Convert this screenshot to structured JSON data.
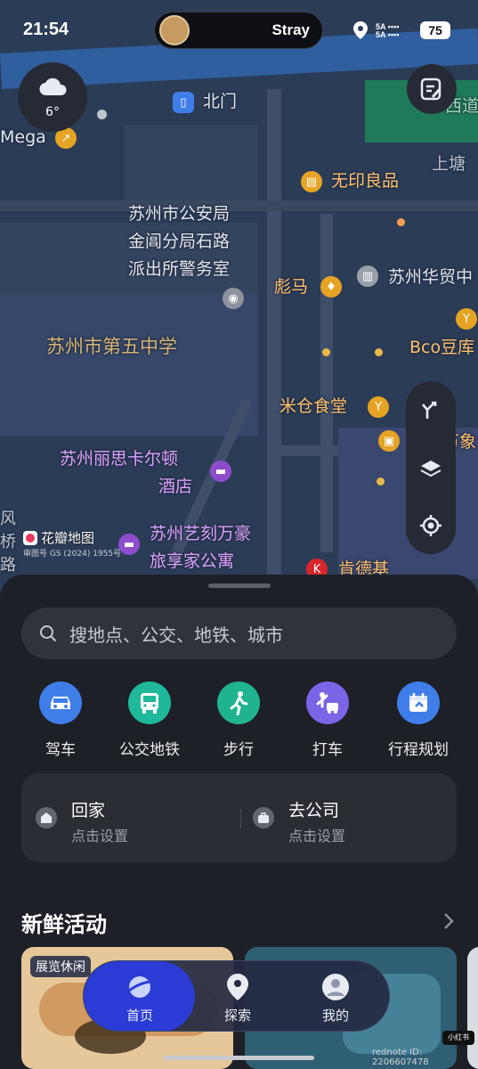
{
  "status_bar": {
    "time": "21:54",
    "now_playing": "Stray",
    "signal_top": "5A",
    "signal_bottom": "5A",
    "battery": "75"
  },
  "weather": {
    "temperature": "6°",
    "icon": "cloud-icon"
  },
  "map_labels": {
    "north_gate": "北门",
    "mega": "Mega",
    "muji": "无印良品",
    "shangtang": "上塘",
    "xidao": "西道",
    "police_l1": "苏州市公安局",
    "police_l2": "金阊分局石路",
    "police_l3": "派出所警务室",
    "puma": "彪马",
    "huamao": "苏州华贸中",
    "school": "苏州市第五中学",
    "bco": "Bco豆库",
    "micang": "米仓食堂",
    "wanfang": "万象",
    "ritz_l1": "苏州丽思卡尔顿",
    "ritz_l2": "酒店",
    "yike_l1": "苏州艺刻万豪",
    "yike_l2": "旅享家公寓",
    "kfc": "肯德基",
    "left_edge": "风\n桥\n路",
    "brand": "花瓣地图",
    "license": "审图号 GS (2024) 1955号"
  },
  "search": {
    "placeholder": "搜地点、公交、地铁、城市"
  },
  "quick_actions": [
    {
      "label": "驾车",
      "icon": "car-icon",
      "color": "#3f7ee8"
    },
    {
      "label": "公交地铁",
      "icon": "bus-icon",
      "color": "#1fb89a"
    },
    {
      "label": "步行",
      "icon": "walk-icon",
      "color": "#1fb48f"
    },
    {
      "label": "打车",
      "icon": "taxi-icon",
      "color": "#7b64e6"
    },
    {
      "label": "行程规划",
      "icon": "calendar-icon",
      "color": "#3f7ee8"
    }
  ],
  "places": [
    {
      "title": "回家",
      "subtitle": "点击设置",
      "icon": "home-icon"
    },
    {
      "title": "去公司",
      "subtitle": "点击设置",
      "icon": "briefcase-icon"
    }
  ],
  "fresh": {
    "title": "新鲜活动",
    "tag": "展览休闲"
  },
  "nav": [
    {
      "label": "首页",
      "icon": "planet-icon"
    },
    {
      "label": "探索",
      "icon": "location-pin-icon"
    },
    {
      "label": "我的",
      "icon": "user-icon"
    }
  ],
  "watermark": {
    "text": "rednote ID: 2206607478",
    "logo": "小红书"
  }
}
